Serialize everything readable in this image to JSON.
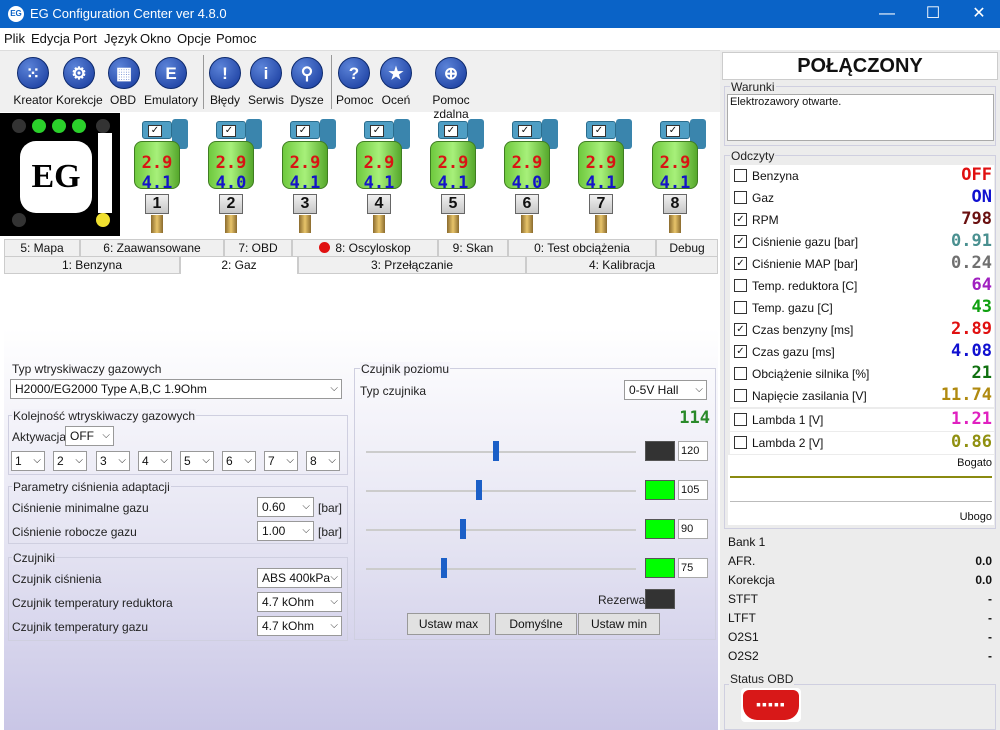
{
  "window": {
    "title": "EG Configuration Center ver 4.8.0",
    "icon_text": "EG",
    "min": "—",
    "max": "☐",
    "close": "✕"
  },
  "menu": [
    "Plik",
    "Edycja",
    "Port",
    "Język",
    "Okno",
    "Opcje",
    "Pomoc"
  ],
  "toolbar": [
    {
      "label": "Kreator",
      "icon": "grid-dots-icon",
      "glyph": "⁙"
    },
    {
      "label": "Korekcje",
      "icon": "gear-icon",
      "glyph": "⚙"
    },
    {
      "label": "OBD",
      "icon": "obd-connector-icon",
      "glyph": "▦"
    },
    {
      "label": "Emulatory",
      "icon": "e-letter-icon",
      "glyph": "E"
    },
    {
      "label": "Błędy",
      "icon": "exclamation-icon",
      "glyph": "!"
    },
    {
      "label": "Serwis",
      "icon": "info-icon",
      "glyph": "i"
    },
    {
      "label": "Dysze",
      "icon": "nozzle-icon",
      "glyph": "⚲"
    },
    {
      "label": "Pomoc",
      "icon": "question-icon",
      "glyph": "?"
    },
    {
      "label": "Oceń",
      "icon": "star-icon",
      "glyph": "★"
    },
    {
      "label": "Pomoc zdalna",
      "icon": "remote-help-icon",
      "glyph": "⊕"
    }
  ],
  "logo": {
    "text": "EG",
    "leds": [
      "#2bd12b",
      "#2bd12b",
      "#2bd12b",
      "#2bd12b"
    ],
    "yellow": "#f0e030"
  },
  "injectors": [
    {
      "num": "1",
      "petrol": "2.9",
      "gas": "4.1"
    },
    {
      "num": "2",
      "petrol": "2.9",
      "gas": "4.0"
    },
    {
      "num": "3",
      "petrol": "2.9",
      "gas": "4.1"
    },
    {
      "num": "4",
      "petrol": "2.9",
      "gas": "4.1"
    },
    {
      "num": "5",
      "petrol": "2.9",
      "gas": "4.1"
    },
    {
      "num": "6",
      "petrol": "2.9",
      "gas": "4.0"
    },
    {
      "num": "7",
      "petrol": "2.9",
      "gas": "4.1"
    },
    {
      "num": "8",
      "petrol": "2.9",
      "gas": "4.1"
    }
  ],
  "tabs_top": [
    "5: Mapa",
    "6: Zaawansowane",
    "7: OBD",
    "8: Oscyloskop",
    "9: Skan",
    "0: Test obciążenia",
    "Debug"
  ],
  "tabs_bottom": [
    "1: Benzyna",
    "2: Gaz",
    "3: Przełączanie",
    "4: Kalibracja"
  ],
  "gas": {
    "injector_type": {
      "title": "Typ wtryskiwaczy gazowych",
      "value": "H2000/EG2000 Type A,B,C 1.9Ohm"
    },
    "order": {
      "title": "Kolejność wtryskiwaczy gazowych",
      "activation_label": "Aktywacja",
      "activation_value": "OFF",
      "slots": [
        "1",
        "2",
        "3",
        "4",
        "5",
        "6",
        "7",
        "8"
      ]
    },
    "adapt": {
      "title": "Parametry ciśnienia adaptacji",
      "min_label": "Ciśnienie minimalne gazu",
      "min_value": "0.60",
      "work_label": "Ciśnienie robocze gazu",
      "work_value": "1.00",
      "unit": "[bar]"
    },
    "sensors": {
      "title": "Czujniki",
      "pressure_label": "Czujnik ciśnienia",
      "pressure_value": "ABS 400kPa",
      "reducer_label": "Czujnik temperatury reduktora",
      "reducer_value": "4.7 kOhm",
      "gas_label": "Czujnik temperatury gazu",
      "gas_value": "4.7 kOhm"
    },
    "level": {
      "title": "Czujnik poziomu",
      "type_label": "Typ czujnika",
      "type_value": "0-5V Hall",
      "reading": "114",
      "thresholds": [
        {
          "value": "120",
          "color": "#333333",
          "level": 0.48
        },
        {
          "value": "105",
          "color": "#00ff00",
          "level": 0.42
        },
        {
          "value": "90",
          "color": "#00ff00",
          "level": 0.36
        },
        {
          "value": "75",
          "color": "#00ff00",
          "level": 0.29
        }
      ],
      "reserve_label": "Rezerwa",
      "reserve_color": "#333333",
      "btn_max": "Ustaw max",
      "btn_default": "Domyślne",
      "btn_min": "Ustaw min"
    }
  },
  "right": {
    "status": "POŁĄCZONY",
    "warunki_title": "Warunki",
    "warunki_text": "Elektrozawory otwarte.",
    "odczyty_title": "Odczyty",
    "readings": [
      {
        "label": "Benzyna",
        "value": "OFF",
        "checked": false,
        "color": "#e01010"
      },
      {
        "label": "Gaz",
        "value": "ON",
        "checked": false,
        "color": "#1010d0"
      },
      {
        "label": "RPM",
        "value": "798",
        "checked": true,
        "color": "#6a1010"
      },
      {
        "label": "Ciśnienie gazu [bar]",
        "value": "0.91",
        "checked": true,
        "color": "#4a9090"
      },
      {
        "label": "Ciśnienie MAP [bar]",
        "value": "0.24",
        "checked": true,
        "color": "#707070"
      },
      {
        "label": "Temp. reduktora [C]",
        "value": "64",
        "checked": false,
        "color": "#a020c0"
      },
      {
        "label": "Temp. gazu [C]",
        "value": "43",
        "checked": false,
        "color": "#10a010"
      },
      {
        "label": "Czas benzyny [ms]",
        "value": "2.89",
        "checked": true,
        "color": "#e01010"
      },
      {
        "label": "Czas gazu [ms]",
        "value": "4.08",
        "checked": true,
        "color": "#1010d0"
      },
      {
        "label": "Obciążenie silnika [%]",
        "value": "21",
        "checked": false,
        "color": "#107010"
      },
      {
        "label": "Napięcie zasilania [V]",
        "value": "11.74",
        "checked": false,
        "color": "#b08a10"
      },
      {
        "label": "Lambda 1 [V]",
        "value": "1.21",
        "checked": false,
        "color": "#e020c0"
      },
      {
        "label": "Lambda 2 [V]",
        "value": "0.86",
        "checked": false,
        "color": "#909010"
      }
    ],
    "lambda_rich": "Bogato",
    "lambda_lean": "Ubogo",
    "bank_title": "Bank 1",
    "bank": [
      {
        "label": "AFR.",
        "value": "0.0"
      },
      {
        "label": "Korekcja",
        "value": "0.0"
      },
      {
        "label": "STFT",
        "value": "-"
      },
      {
        "label": "LTFT",
        "value": "-"
      },
      {
        "label": "O2S1",
        "value": "-"
      },
      {
        "label": "O2S2",
        "value": "-"
      }
    ],
    "obd_title": "Status OBD"
  }
}
